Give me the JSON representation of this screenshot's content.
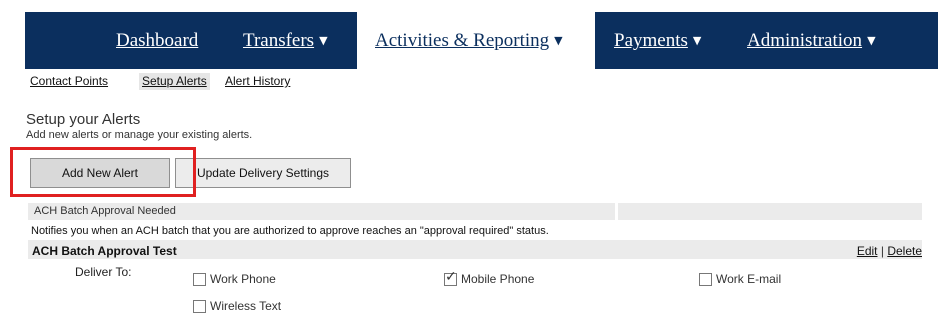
{
  "nav": {
    "items": [
      {
        "label": "Dashboard",
        "has_dropdown": false
      },
      {
        "label": "Transfers",
        "has_dropdown": true
      },
      {
        "label": "Activities & Reporting",
        "has_dropdown": true,
        "active": true
      },
      {
        "label": "Payments",
        "has_dropdown": true
      },
      {
        "label": "Administration",
        "has_dropdown": true
      }
    ],
    "dropdown_icon": "chevron-down-icon",
    "background": "#0b2f5e"
  },
  "subnav": {
    "items": [
      {
        "label": "Contact Points"
      },
      {
        "label": "Setup Alerts",
        "selected": true
      },
      {
        "label": "Alert History"
      }
    ]
  },
  "page": {
    "title": "Setup your Alerts",
    "subtitle": "Add new alerts or manage your existing alerts."
  },
  "buttons": {
    "add_label": "Add New Alert",
    "update_label": "Update Delivery Settings",
    "highlight_color": "#e02020"
  },
  "alert_group": {
    "type": "ACH Batch Approval Needed",
    "description": "Notifies you when an ACH batch that you are authorized to approve reaches an \"approval required\" status."
  },
  "alert": {
    "name": "ACH Batch Approval Test",
    "edit_label": "Edit",
    "separator": "|",
    "delete_label": "Delete",
    "deliver_to_label": "Deliver To:",
    "options": [
      {
        "label": "Work Phone",
        "checked": false
      },
      {
        "label": "Mobile Phone",
        "checked": true
      },
      {
        "label": "Work E-mail",
        "checked": false
      },
      {
        "label": "Wireless Text",
        "checked": false
      }
    ]
  }
}
